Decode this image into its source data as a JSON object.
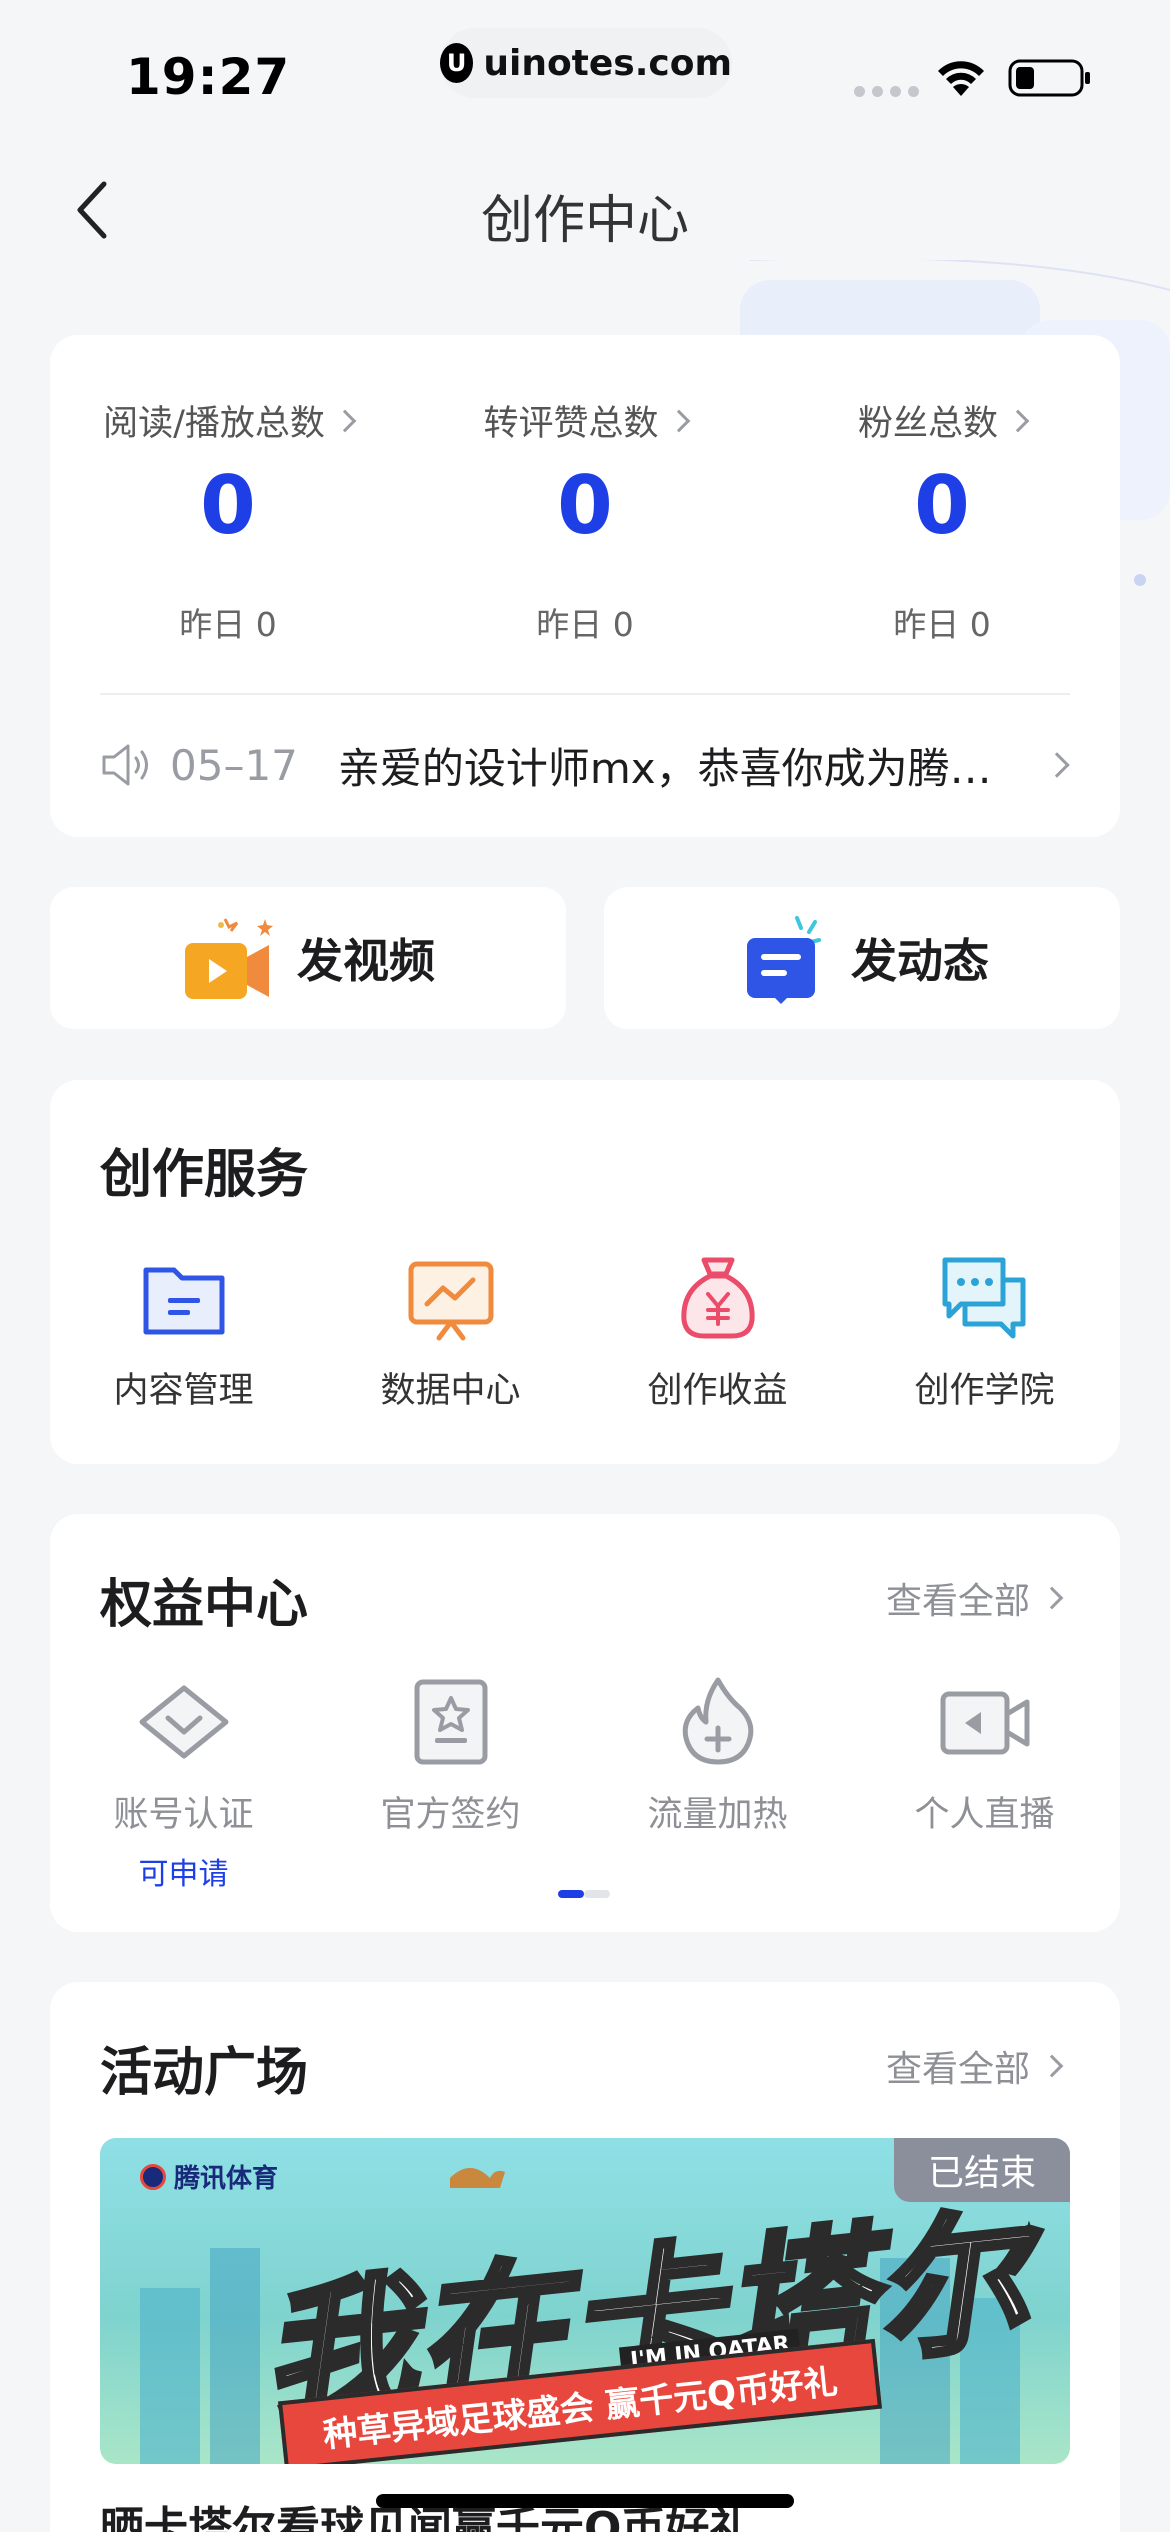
{
  "status_bar": {
    "time": "19:27",
    "url": "uinotes.com",
    "url_logo": "U"
  },
  "nav": {
    "title": "创作中心"
  },
  "stats": {
    "items": [
      {
        "label": "阅读/播放总数",
        "value": "0",
        "sub": "昨日 0"
      },
      {
        "label": "转评赞总数",
        "value": "0",
        "sub": "昨日 0"
      },
      {
        "label": "粉丝总数",
        "value": "0",
        "sub": "昨日 0"
      }
    ],
    "notice": {
      "date": "05–17",
      "text": "亲爱的设计师mx，恭喜你成为腾讯号创作者"
    }
  },
  "publish": {
    "video_label": "发视频",
    "post_label": "发动态"
  },
  "services": {
    "title": "创作服务",
    "items": [
      {
        "label": "内容管理"
      },
      {
        "label": "数据中心"
      },
      {
        "label": "创作收益"
      },
      {
        "label": "创作学院"
      }
    ]
  },
  "rights": {
    "title": "权益中心",
    "view_all": "查看全部",
    "items": [
      {
        "label": "账号认证",
        "badge": "可申请"
      },
      {
        "label": "官方签约"
      },
      {
        "label": "流量加热"
      },
      {
        "label": "个人直播"
      }
    ]
  },
  "activity": {
    "title": "活动广场",
    "view_all": "查看全部",
    "banner": {
      "brand": "腾讯体育",
      "headline": "我在卡塔尔",
      "english": "I'M IN QATAR",
      "slogan": "种草异域足球盛会  赢千元Q币好礼",
      "tag": "已结束"
    },
    "item_title": "晒卡塔尔看球见闻赢千元Q币好礼"
  },
  "colors": {
    "accent": "#1f3fe6",
    "background": "#f5f6f8",
    "card": "#ffffff",
    "muted": "#8e9096"
  }
}
